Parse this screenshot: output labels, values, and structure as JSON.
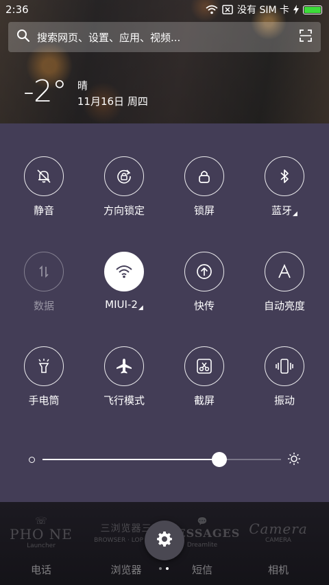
{
  "status_bar": {
    "time": "2:36",
    "sim_text": "没有 SIM 卡",
    "icons": [
      "wifi-icon",
      "no-sim-icon",
      "charging-icon",
      "battery-icon"
    ],
    "battery_color": "#3ddc3a"
  },
  "search": {
    "placeholder": "搜索网页、设置、应用、视频...",
    "icons": [
      "search-icon",
      "scan-icon"
    ]
  },
  "weather": {
    "temperature": "-2°",
    "condition": "晴",
    "date": "11月16日 周四"
  },
  "quick_settings": {
    "row1": [
      {
        "label": "静音",
        "icon": "mute-bell-icon",
        "state": "off"
      },
      {
        "label": "方向锁定",
        "icon": "rotation-lock-icon",
        "state": "off"
      },
      {
        "label": "锁屏",
        "icon": "lock-icon",
        "state": "off"
      },
      {
        "label": "蓝牙",
        "icon": "bluetooth-icon",
        "state": "off",
        "has_more": true
      }
    ],
    "row2": [
      {
        "label": "数据",
        "icon": "mobile-data-icon",
        "state": "disabled"
      },
      {
        "label": "MIUI-2",
        "icon": "wifi-icon",
        "state": "on",
        "has_more": true
      },
      {
        "label": "快传",
        "icon": "transfer-icon",
        "state": "off"
      },
      {
        "label": "自动亮度",
        "icon": "auto-brightness-icon",
        "state": "off"
      }
    ],
    "row3": [
      {
        "label": "手电筒",
        "icon": "flashlight-icon",
        "state": "off"
      },
      {
        "label": "飞行模式",
        "icon": "airplane-icon",
        "state": "off"
      },
      {
        "label": "截屏",
        "icon": "screenshot-icon",
        "state": "off"
      },
      {
        "label": "振动",
        "icon": "vibrate-icon",
        "state": "off"
      }
    ],
    "more_indicator": "◢"
  },
  "brightness": {
    "level": 0.74,
    "icons": [
      "brightness-low-icon",
      "brightness-high-icon"
    ]
  },
  "dock": {
    "items": [
      {
        "label": "电话",
        "logo": "PHO NE",
        "logo_sub": "Launcher"
      },
      {
        "label": "浏览器",
        "logo": "三浏览器三",
        "logo_sub": "BROWSER · LOP TEM"
      },
      {
        "label": "短信",
        "logo": "MESSAGES",
        "logo_sub": "Dreamlite"
      },
      {
        "label": "相机",
        "logo": "Camera",
        "logo_sub": "CAMERA"
      }
    ],
    "settings_icon": "gear-icon",
    "page_count": 2,
    "current_page": 1
  },
  "colors": {
    "panel_bg": "#433d56",
    "dock_bg": "#1c1a21",
    "active_tile": "#ffffff"
  }
}
